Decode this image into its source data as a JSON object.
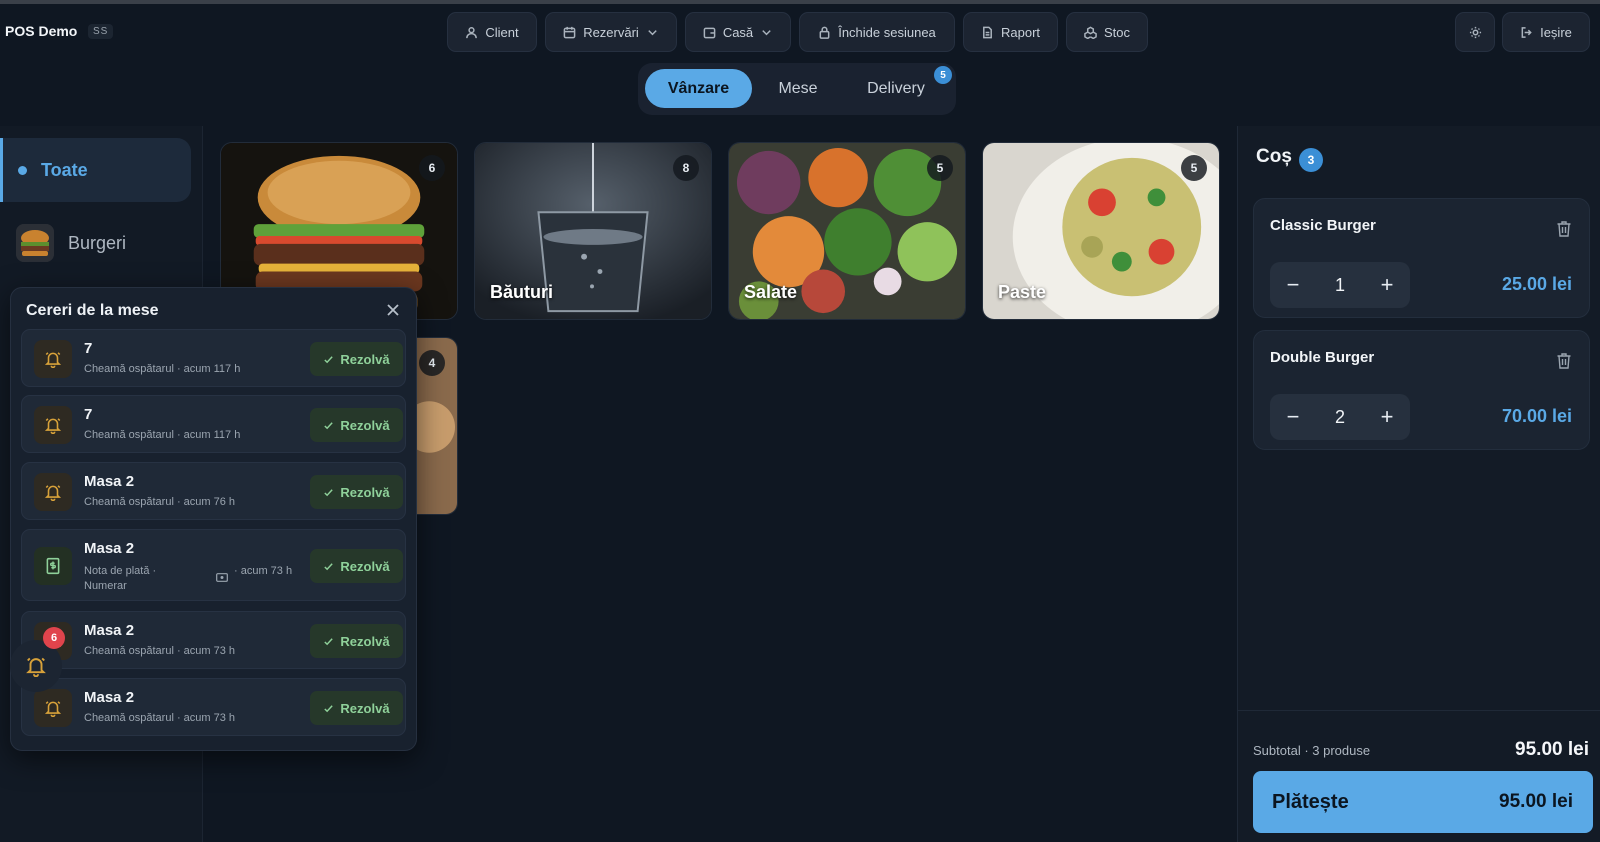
{
  "app": {
    "brand": "POS Demo",
    "badge": "SS"
  },
  "toolbar": {
    "client": "Client",
    "rezervari": "Rezervări",
    "casa": "Casă",
    "inchide": "Închide sesiunea",
    "raport": "Raport",
    "stoc": "Stoc",
    "iesire": "Ieșire"
  },
  "modes": {
    "tabs": [
      {
        "label": "Vânzare",
        "active": true
      },
      {
        "label": "Mese",
        "active": false
      },
      {
        "label": "Delivery",
        "active": false
      }
    ],
    "delivery_badge": "5"
  },
  "sidebar": {
    "all_label": "Toate",
    "burgeri_label": "Burgeri",
    "notification_count": "6"
  },
  "products": [
    {
      "name": "",
      "count": "6",
      "image": "burger"
    },
    {
      "name": "Băuturi",
      "count": "8",
      "image": "water-glass"
    },
    {
      "name": "Salate",
      "count": "5",
      "image": "salad"
    },
    {
      "name": "Paste",
      "count": "5",
      "image": "pasta"
    },
    {
      "name": "",
      "count": "4",
      "image": "partial"
    }
  ],
  "requests": {
    "title": "Cereri de la mese",
    "resolve_label": "Rezolvă",
    "items": [
      {
        "table": "7",
        "type": "Cheamă ospătarul",
        "time": "· acum 117 h",
        "icon": "bell-icon"
      },
      {
        "table": "7",
        "type": "Cheamă ospătarul",
        "time": "· acum 117 h",
        "icon": "bell-icon"
      },
      {
        "table": "Masa 2",
        "type": "Cheamă ospătarul",
        "time": "· acum 76 h",
        "icon": "bell-icon"
      },
      {
        "table": "Masa 2",
        "type": "Nota de plată · Numerar",
        "time": "· acum 73 h",
        "icon": "bill-icon"
      },
      {
        "table": "Masa 2",
        "type": "Cheamă ospătarul",
        "time": "· acum 73 h",
        "icon": "bell-icon"
      },
      {
        "table": "Masa 2",
        "type": "Cheamă ospătarul",
        "time": "· acum 73 h",
        "icon": "bell-icon"
      }
    ]
  },
  "cart": {
    "title": "Coș",
    "count": "3",
    "items": [
      {
        "name": "Classic Burger",
        "qty": "1",
        "price": "25.00 lei"
      },
      {
        "name": "Double Burger",
        "qty": "2",
        "price": "70.00 lei"
      }
    ],
    "subtotal_label": "Subtotal · 3 produse",
    "subtotal_value": "95.00 lei",
    "pay_label": "Plătește",
    "pay_total": "95.00 lei"
  },
  "colors": {
    "accent": "#5aa9e6",
    "background": "#0f1722",
    "resolve_text": "#8fd19a",
    "badge_red": "#e0444c"
  }
}
